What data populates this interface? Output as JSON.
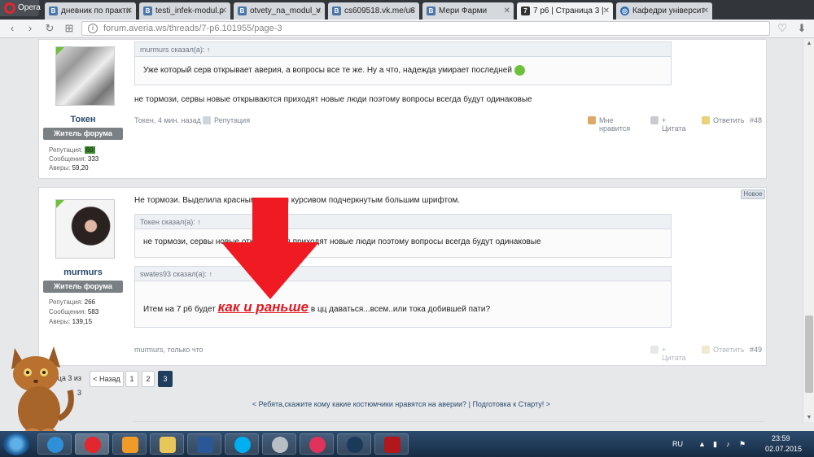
{
  "browser": {
    "menu_label": "Opera",
    "tabs": [
      {
        "title": "дневник по практи",
        "icon": "vk"
      },
      {
        "title": "testi_infek-modul.p",
        "icon": "vk"
      },
      {
        "title": "otvety_na_modul_v",
        "icon": "vk"
      },
      {
        "title": "cs609518.vk.me/u6",
        "icon": "vk"
      },
      {
        "title": "Мери Фарми",
        "icon": "vk"
      },
      {
        "title": "7 р6 | Страница 3 |",
        "icon": "forum"
      },
      {
        "title": "Кафедри університ",
        "icon": "globe"
      }
    ],
    "url": "forum.averia.ws/threads/7-p6.101955/page-3"
  },
  "posts": [
    {
      "username": "Токен",
      "badge": "Житель форума",
      "stats": {
        "rep_label": "Репутация:",
        "rep_value": "60",
        "msgs_label": "Сообщения:",
        "msgs_value": "333",
        "avers_label": "Аверы:",
        "avers_value": "59,20"
      },
      "quote_head": "murmurs сказал(а): ↑",
      "quote_text": "Уже который серв открывает аверия, а вопросы все те же. Ну а что, надежда умирает последней",
      "text": "не тормози, сервы новые открываются приходят новые люди поэтому вопросы всегда будут одинаковые",
      "meta": "Токен, 4 мин. назад",
      "rep_link": "Репутация",
      "like": "Мне нравится",
      "quote_link": "+ Цитата",
      "reply": "Ответить",
      "number": "#48"
    },
    {
      "username": "murmurs",
      "badge": "Житель форума",
      "new_badge": "Новое",
      "stats": {
        "rep_label": "Репутация:",
        "rep_value": "266",
        "msgs_label": "Сообщения:",
        "msgs_value": "583",
        "avers_label": "Аверы:",
        "avers_value": "139,15"
      },
      "text": "Не тормози. Выделила красным жирным курсивом подчеркнутым большим шрифтом.",
      "quote1_head": "Токен сказал(а): ↑",
      "quote1_text": "не тормози, сервы новые открываются приходят новые люди поэтому вопросы всегда будут одинаковые",
      "quote2_head": "swates93 сказал(а): ↑",
      "quote2_pre": "Итем на 7 р6 будет",
      "quote2_big": "как и раньше",
      "quote2_post": "в цц даваться...всем..или тока добившей пати?",
      "meta": "murmurs, только что",
      "quote_link": "+ Цитата",
      "reply": "Ответить",
      "number": "#49"
    }
  ],
  "pager": {
    "label": "Страница 3 из 3",
    "prev": "< Назад",
    "pages": [
      "1",
      "2",
      "3"
    ],
    "current": "3"
  },
  "thread_nav": {
    "prev": "< Ребята,скажите кому какие костюмчики нравятся на аверии?",
    "sep": "|",
    "next": "Подготовка к Старту! >"
  },
  "taskbar": {
    "apps": [
      "ie",
      "opera",
      "media",
      "explorer",
      "word",
      "skype",
      "disc",
      "itunes",
      "steam",
      "game"
    ],
    "lang": "RU",
    "time": "23:59",
    "date": "02.07.2015"
  },
  "colors": {
    "accent": "#1f3e5c",
    "highlight": "#e2181f",
    "tab_bar": "#32363b"
  }
}
